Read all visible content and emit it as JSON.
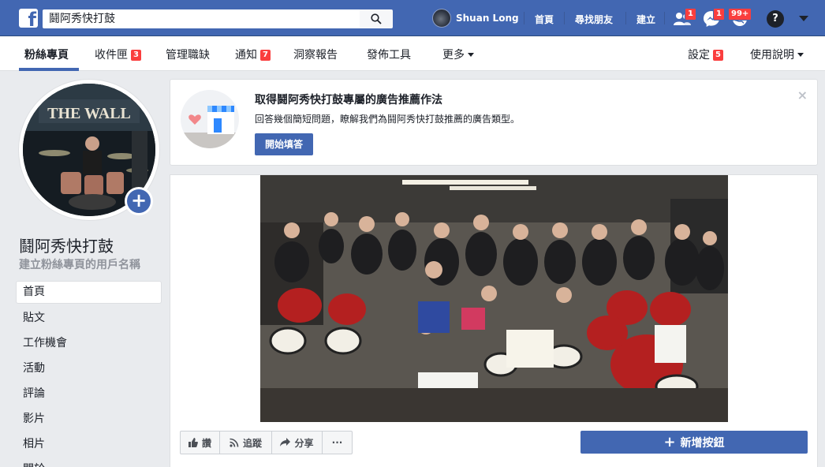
{
  "topbar": {
    "search_value": "鬪阿秀快打鼓",
    "user_name": "Shuan Long",
    "links": [
      "首頁",
      "尋找朋友",
      "建立"
    ],
    "friend_requests_badge": "1",
    "messages_badge": "1",
    "notifications_badge": "99+"
  },
  "tabs": {
    "page": "粉絲專頁",
    "inbox": "收件匣",
    "inbox_badge": "3",
    "jobs": "管理職缺",
    "notifications": "通知",
    "notifications_badge": "7",
    "insights": "洞察報告",
    "publishing": "發佈工具",
    "more": "更多",
    "settings": "設定",
    "settings_badge": "5",
    "help": "使用說明"
  },
  "profile": {
    "page_name": "鬪阿秀快打鼓",
    "create_username": "建立粉絲專頁的用戶名稱",
    "cover_sign": "THE WALL"
  },
  "sidebar": {
    "items": [
      "首頁",
      "貼文",
      "工作機會",
      "活動",
      "評論",
      "影片",
      "相片",
      "關於"
    ],
    "active": "首頁"
  },
  "ad_card": {
    "title": "取得鬪阿秀快打鼓專屬的廣告推薦作法",
    "text": "回答幾個簡短問題，瞭解我們為鬪阿秀快打鼓推薦的廣告類型。",
    "button": "開始填答",
    "close": "×"
  },
  "actions": {
    "like": "讚",
    "follow": "追蹤",
    "share": "分享",
    "more": "···",
    "add_button": "新增按鈕"
  },
  "colors": {
    "brand_blue": "#4267b2",
    "badge_red": "#fa3e3e",
    "page_bg": "#e9ebee"
  }
}
